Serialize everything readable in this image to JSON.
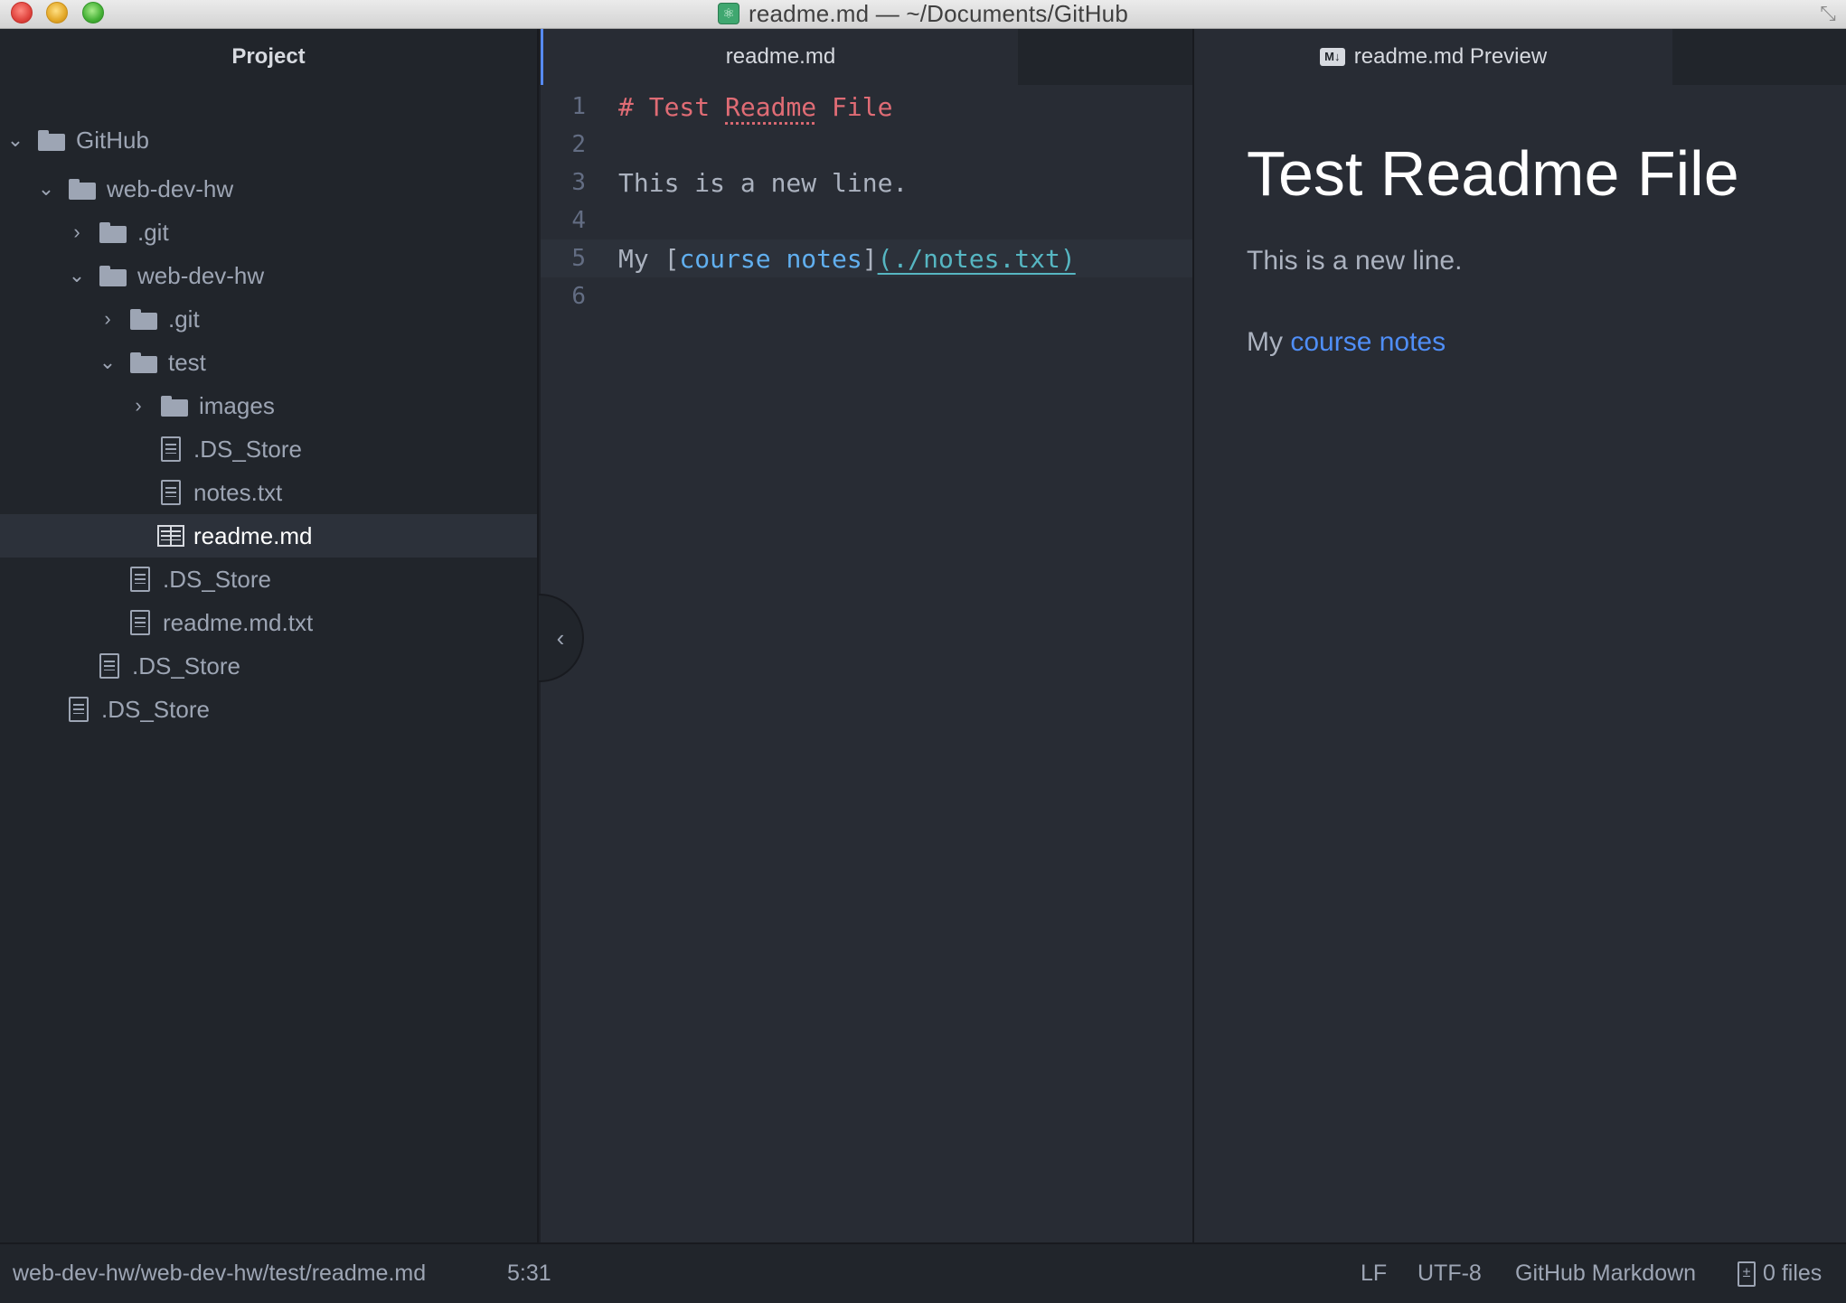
{
  "window": {
    "title": "readme.md — ~/Documents/GitHub"
  },
  "sidebar": {
    "header": "Project",
    "tree": [
      {
        "name": "GitHub",
        "kind": "folder",
        "expanded": true,
        "depth": 0
      },
      {
        "name": "web-dev-hw",
        "kind": "folder",
        "expanded": true,
        "depth": 1
      },
      {
        "name": ".git",
        "kind": "folder",
        "expanded": false,
        "depth": 2
      },
      {
        "name": "web-dev-hw",
        "kind": "folder",
        "expanded": true,
        "depth": 2
      },
      {
        "name": ".git",
        "kind": "folder",
        "expanded": false,
        "depth": 3
      },
      {
        "name": "test",
        "kind": "folder",
        "expanded": true,
        "depth": 3
      },
      {
        "name": "images",
        "kind": "folder",
        "expanded": false,
        "depth": 4
      },
      {
        "name": ".DS_Store",
        "kind": "file",
        "depth": 4
      },
      {
        "name": "notes.txt",
        "kind": "file",
        "depth": 4
      },
      {
        "name": "readme.md",
        "kind": "markdown",
        "depth": 4,
        "selected": true
      },
      {
        "name": ".DS_Store",
        "kind": "file",
        "depth": 3
      },
      {
        "name": "readme.md.txt",
        "kind": "file",
        "depth": 3
      },
      {
        "name": ".DS_Store",
        "kind": "file",
        "depth": 2
      },
      {
        "name": ".DS_Store",
        "kind": "file",
        "depth": 1
      }
    ]
  },
  "editor": {
    "tab": "readme.md",
    "lines": [
      {
        "num": "1",
        "parts": [
          {
            "t": "# Test ",
            "c": "md-h"
          },
          {
            "t": "Readme",
            "c": "md-h spell"
          },
          {
            "t": " File",
            "c": "md-h"
          }
        ]
      },
      {
        "num": "2",
        "parts": []
      },
      {
        "num": "3",
        "parts": [
          {
            "t": "This is a new line.",
            "c": ""
          }
        ]
      },
      {
        "num": "4",
        "parts": []
      },
      {
        "num": "5",
        "cursor": true,
        "parts": [
          {
            "t": "My ",
            "c": ""
          },
          {
            "t": "[",
            "c": ""
          },
          {
            "t": "course notes",
            "c": "md-link"
          },
          {
            "t": "]",
            "c": ""
          },
          {
            "t": "(./notes.txt)",
            "c": "md-url"
          }
        ]
      },
      {
        "num": "6",
        "parts": []
      }
    ]
  },
  "preview": {
    "tab": "readme.md Preview",
    "badge": "M↓",
    "heading": "Test Readme File",
    "paragraph": "This is a new line.",
    "link_prefix": "My ",
    "link_text": "course notes"
  },
  "statusbar": {
    "path": "web-dev-hw/web-dev-hw/test/readme.md",
    "cursor": "5:31",
    "line_ending": "LF",
    "encoding": "UTF-8",
    "grammar": "GitHub Markdown",
    "files": "0 files"
  },
  "colors": {
    "accent": "#568af2",
    "link": "#4f8ef7",
    "heading_md": "#e06c75"
  }
}
